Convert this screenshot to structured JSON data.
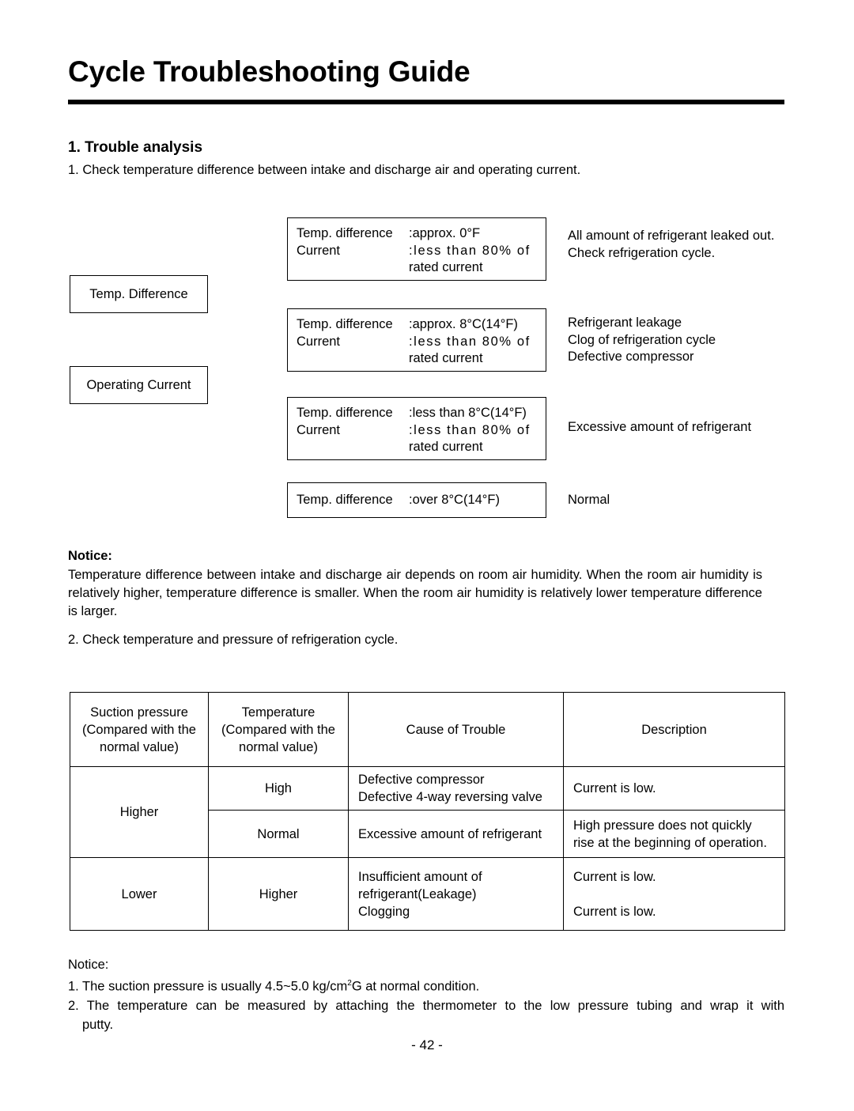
{
  "document": {
    "title": "Cycle Troubleshooting Guide",
    "page_number": "- 42 -"
  },
  "section": {
    "heading": "1. Trouble analysis",
    "step_1": "1. Check temperature difference between intake and discharge air and operating current.",
    "step_2": "2. Check temperature and pressure of refrigeration cycle."
  },
  "diagram": {
    "inputs": [
      {
        "label": "Temp. Difference"
      },
      {
        "label": "Operating Current"
      }
    ],
    "conditions": [
      {
        "key_1": "Temp. difference",
        "value_1": ":approx. 0°F",
        "key_2": "Current",
        "value_2": ":less than 80% of",
        "value_2_cont": "rated current",
        "results": [
          "All amount of refrigerant leaked out.",
          "Check refrigeration cycle."
        ]
      },
      {
        "key_1": "Temp. difference",
        "value_1": ":approx. 8°C(14°F)",
        "key_2": "Current",
        "value_2": ":less than 80% of",
        "value_2_cont": "rated current",
        "results": [
          "Refrigerant leakage",
          "Clog of refrigeration cycle",
          "Defective compressor"
        ]
      },
      {
        "key_1": "Temp. difference",
        "value_1": ":less than 8°C(14°F)",
        "key_2": "Current",
        "value_2": ":less than 80% of",
        "value_2_cont": "rated current",
        "results": [
          "Excessive amount of refrigerant"
        ]
      },
      {
        "key_1": "Temp. difference",
        "value_1": ":over 8°C(14°F)",
        "results": [
          "Normal"
        ]
      }
    ]
  },
  "notice_1": {
    "heading": "Notice:",
    "body": "Temperature difference between intake and discharge air depends on room air humidity. When the room air humidity is relatively higher, temperature difference is smaller. When the room air humidity is relatively lower temperature difference is larger."
  },
  "table": {
    "headers": {
      "col_1_line_1": "Suction pressure",
      "col_1_line_2": "(Compared with the",
      "col_1_line_3": "normal value)",
      "col_2_line_1": "Temperature",
      "col_2_line_2": "(Compared with the",
      "col_2_line_3": "normal value)",
      "col_3": "Cause of Trouble",
      "col_4": "Description"
    },
    "rows": [
      {
        "suction_pressure": "Higher",
        "temperature": "High",
        "cause_line_1": "Defective compressor",
        "cause_line_2": "Defective 4-way reversing valve",
        "description_line_1": "Current is low.",
        "description_line_2": ""
      },
      {
        "temperature": "Normal",
        "cause_line_1": "Excessive amount of refrigerant",
        "cause_line_2": "",
        "description_line_1": "High pressure does not quickly",
        "description_line_2": "rise at the beginning of operation."
      },
      {
        "suction_pressure": "Lower",
        "temperature": "Higher",
        "cause_line_1": "Insufficient amount of",
        "cause_line_2": "refrigerant(Leakage)",
        "cause_line_3": "Clogging",
        "description_line_1": "Current is low.",
        "description_line_2": "Current is low."
      }
    ]
  },
  "notice_2": {
    "heading": "Notice:",
    "item_1": "1. The suction pressure is usually 4.5~5.0 kg/cm",
    "item_1_sup": "2",
    "item_1_tail": "G at normal condition.",
    "item_2": "2. The temperature can be measured by attaching the thermometer to the low pressure tubing and wrap it with",
    "item_2_cont": "putty."
  }
}
